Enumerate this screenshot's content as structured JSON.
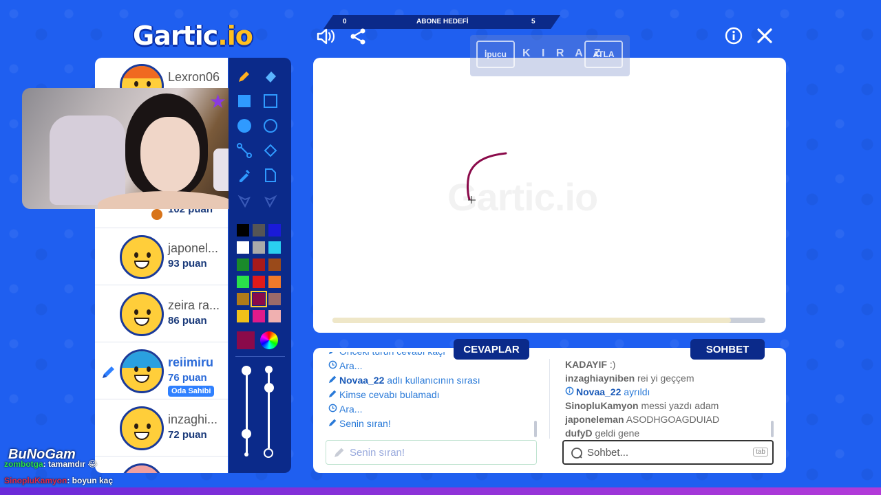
{
  "logo": {
    "text_main": "Gartic",
    "text_accent": ".io"
  },
  "topbar": {
    "left_value": "0",
    "label": "ABONE HEDEFİ",
    "right_value": "5"
  },
  "players": [
    {
      "name": "Lexron06",
      "score": "",
      "hair": "#f06a20"
    },
    {
      "name": "",
      "score": "102 puan",
      "hair": ""
    },
    {
      "name": "japonel...",
      "score": "93 puan",
      "hair": ""
    },
    {
      "name": "zeira ra...",
      "score": "86 puan",
      "hair": ""
    },
    {
      "name": "reiimiru",
      "score": "76 puan",
      "badge": "Oda Sahibi",
      "hair": "#2aa0e0"
    },
    {
      "name": "inzaghi...",
      "score": "72 puan",
      "hair": ""
    }
  ],
  "palette": [
    "#000000",
    "#555555",
    "#1a1ad8",
    "#ffffff",
    "#aaaaaa",
    "#2ad0f0",
    "#1a8a2a",
    "#a81a1a",
    "#9a4a1a",
    "#2ae04a",
    "#e01a1a",
    "#f07a2a",
    "#b07a1a",
    "#8a0a4a",
    "#9a6a6a",
    "#f0c01a",
    "#e01a8a",
    "#f0b0b0"
  ],
  "current_color": "#8a0a4a",
  "hint": {
    "hint_label": "İpucu",
    "word": "K I R A Z",
    "skip_label": "ATLA"
  },
  "canvas": {
    "watermark": "Gartic.io",
    "progress": 0.92
  },
  "answers_tab": "CEVAPLAR",
  "chat_tab": "SOHBET",
  "answers": [
    {
      "icon": "pencil",
      "bold": "",
      "text": "Önceki turun cevabı kaçı"
    },
    {
      "icon": "clock",
      "bold": "",
      "text": "Ara..."
    },
    {
      "icon": "pencil",
      "bold": "Novaa_22",
      "text": " adlı kullanıcının sırası"
    },
    {
      "icon": "pencil",
      "bold": "",
      "text": "Kimse cevabı bulamadı"
    },
    {
      "icon": "clock",
      "bold": "",
      "text": "Ara..."
    },
    {
      "icon": "pencil",
      "bold": "",
      "text": "Senin sıran!"
    }
  ],
  "chat": [
    {
      "type": "msg",
      "user": "KADAYIF",
      "text": " :)"
    },
    {
      "type": "msg",
      "user": "inzaghiayniben",
      "text": " rei yi geççem"
    },
    {
      "type": "info",
      "user": "Novaa_22",
      "text": " ayrıldı"
    },
    {
      "type": "msg",
      "user": "SinopluKamyon",
      "text": " messi yazdı adam"
    },
    {
      "type": "msg",
      "user": "japoneleman",
      "text": " ASODHGOAGDUIAD"
    },
    {
      "type": "msg",
      "user": "dufyD",
      "text": " geldi gene"
    }
  ],
  "answer_input": {
    "placeholder": "Senin sıran!"
  },
  "chat_input": {
    "placeholder": "Sohbet...",
    "shortcut": "tab"
  },
  "overlay": {
    "logo": "BuNoGam",
    "line1_user": "zombotga",
    "line1_text": ": tamamdır 😂",
    "line2_user": "SinopluKamyon",
    "line2_text": ": boyun kaç"
  }
}
